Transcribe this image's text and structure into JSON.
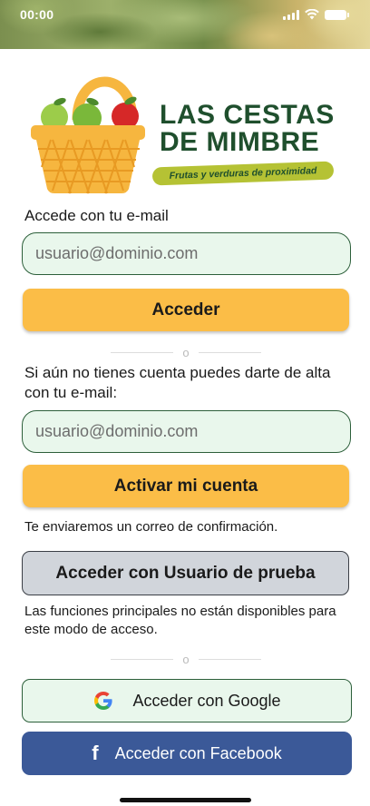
{
  "status_bar": {
    "time": "00:00"
  },
  "brand": {
    "line1": "LAS CESTAS",
    "line2": "DE MIMBRE",
    "tagline": "Frutas y verduras de proximidad"
  },
  "login": {
    "label": "Accede con tu e-mail",
    "email_placeholder": "usuario@dominio.com",
    "button": "Acceder"
  },
  "divider1": "o",
  "signup": {
    "label": "Si aún no tienes cuenta puedes darte de alta con tu e-mail:",
    "email_placeholder": "usuario@dominio.com",
    "button": "Activar mi cuenta",
    "note": "Te enviaremos un correo de confirmación."
  },
  "test_user": {
    "button": "Acceder con Usuario de prueba",
    "note": "Las funciones principales no están disponibles para este modo de acceso."
  },
  "divider2": "o",
  "social": {
    "google_label": "Acceder con Google",
    "google_icon": "google-icon",
    "facebook_label": "Acceder con Facebook",
    "facebook_icon": "facebook-icon"
  },
  "colors": {
    "primary_button": "#fbbd47",
    "input_bg": "#e9f7ec",
    "brand_green": "#1f4f2d",
    "facebook_blue": "#3b5998",
    "test_button": "#d1d5db"
  }
}
